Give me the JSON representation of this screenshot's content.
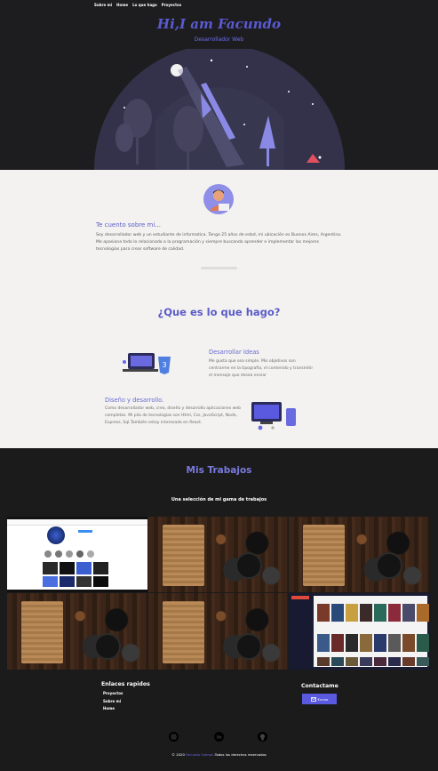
{
  "nav": {
    "items": [
      "Sobre mi",
      "Home",
      "Lo que hago",
      "Proyectos"
    ]
  },
  "hero": {
    "title": "Hi,I am Facundo",
    "subtitle": "Desarrollador Web"
  },
  "about": {
    "title": "Te cuento sobre mi...",
    "text": "Soy desarrollador web y un estudiante de informatica. Tengo 25 años de edad, mi ubicación es Buenos Aires, Argentina. Me apasiona todo lo relacionado a la programación y siempre buscando aprender e implementar las mejores tecnologias para crear software de calidad."
  },
  "services": {
    "title": "¿Que es lo que hago?",
    "ideas": {
      "title": "Desarrollar Ideas",
      "text": "Me gusta que sea simple. Mis objetivos son centrarme en la tipografia, el contenido y transmitir el mensaje que desea enviar"
    },
    "design": {
      "title": "Diseño y desarrollo.",
      "text": "Como desarrollador web, creo, diseño y desarrollo aplicaciones web completas. Mi pila de tecnologias son Html, Css, JavaScript, Node, Express, Sql.También estoy interesado en React."
    }
  },
  "works": {
    "title": "Mis Trabajos",
    "subtitle": "Una selección de mi gama de trabajos",
    "projects": [
      "instagram-clone",
      "food-board",
      "food-board",
      "food-board",
      "food-board",
      "peliculas-app"
    ]
  },
  "footer": {
    "links_title": "Enlaces rapidos",
    "links": [
      "Proyectos",
      "Sobre mi",
      "Home"
    ],
    "contact_title": "Contactame",
    "send_label": "Enviar",
    "copyright_prefix": "© 2020",
    "copyright_name": "Facundo Colman",
    "copyright_suffix": ".Todos los derechos reservados"
  },
  "colors": {
    "accent": "#5b5bc8",
    "hero_bg": "#1d1d1f",
    "about_bg": "#f3f2f0",
    "works_bg": "#1b1b1b"
  },
  "icons": [
    "user-avatar-icon",
    "send-icon",
    "instagram-icon",
    "linkedin-icon",
    "github-icon"
  ]
}
